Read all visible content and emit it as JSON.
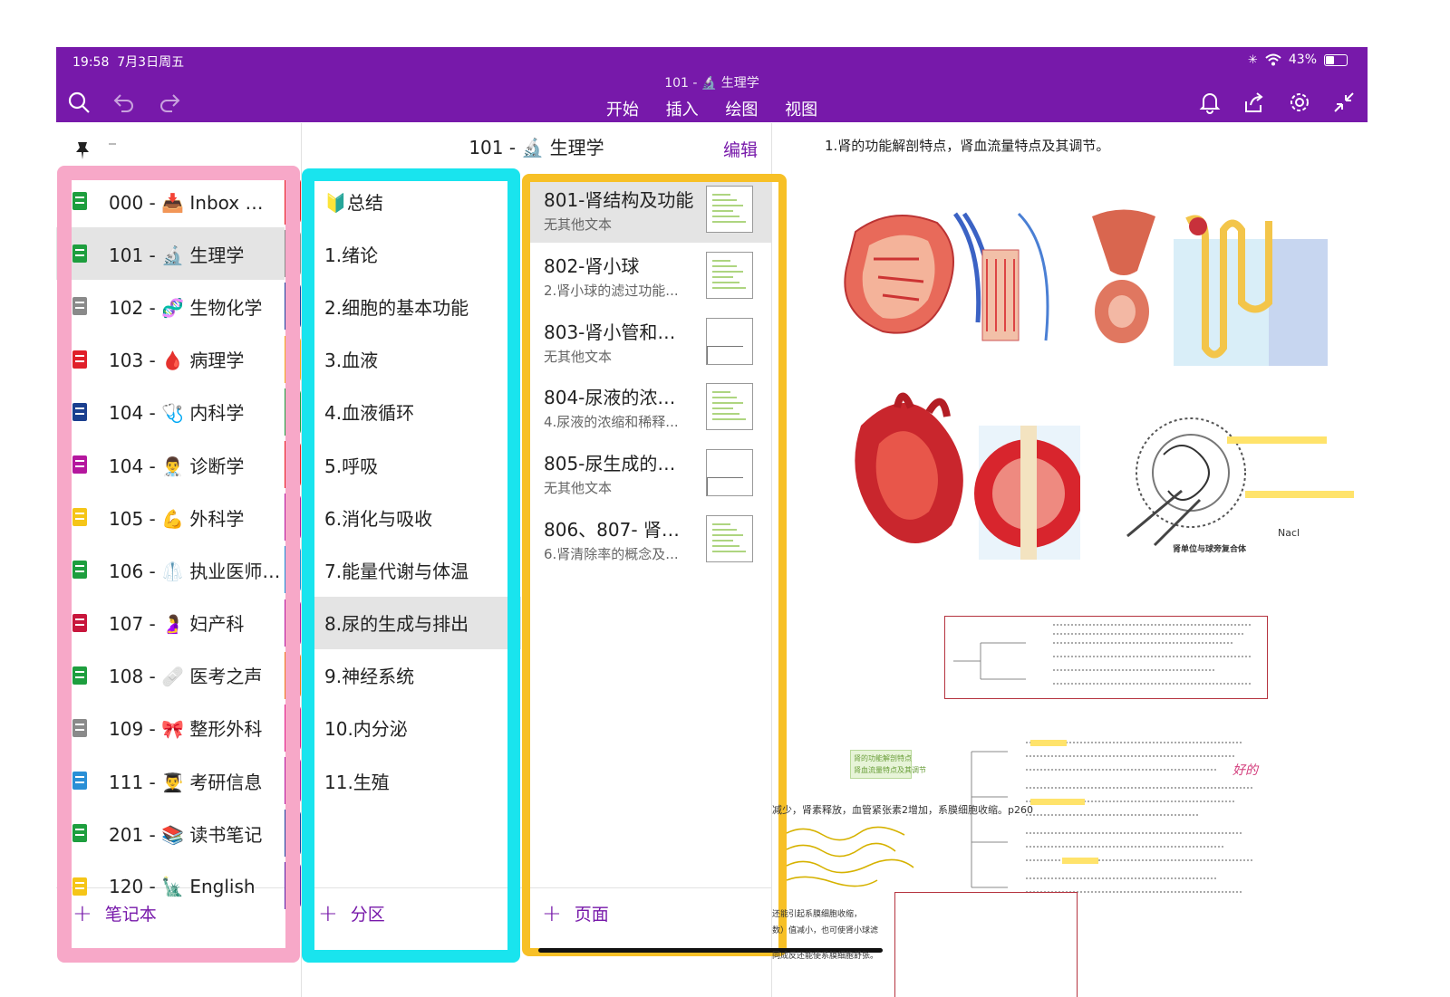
{
  "status": {
    "time": "19:58",
    "date": "7月3日周五",
    "battery": "43%",
    "battery_level": 0.43
  },
  "toolbar": {
    "doc_title": "101 - 🔬 生理学",
    "tabs": [
      "开始",
      "插入",
      "绘图",
      "视图"
    ]
  },
  "header": {
    "notebook_title": "101 - 🔬 生理学",
    "edit_label": "编辑"
  },
  "notebooks": [
    {
      "label": "000 - 📥 Inbox 文…",
      "color": "#1e9e3e"
    },
    {
      "label": "101 - 🔬 生理学",
      "color": "#1e9e3e",
      "selected": true
    },
    {
      "label": "102 - 🧬 生物化学",
      "color": "#8a8a8a"
    },
    {
      "label": "103 - 🩸 病理学",
      "color": "#e0202a"
    },
    {
      "label": "104 - 🩺 内科学",
      "color": "#1b3f8f"
    },
    {
      "label": "104 - 👨‍⚕️ 诊断学",
      "color": "#b5179e"
    },
    {
      "label": "105 - 💪 外科学",
      "color": "#f5c518"
    },
    {
      "label": "106 - 🥼 执业医师…",
      "color": "#1e9e3e"
    },
    {
      "label": "107 - 🤰 妇产科",
      "color": "#c8163c"
    },
    {
      "label": "108 - 🩹 医考之声",
      "color": "#1e9e3e"
    },
    {
      "label": "109 - 🎀 整形外科",
      "color": "#8a8a8a"
    },
    {
      "label": "111 - 👨‍🎓 考研信息",
      "color": "#2a8fd6"
    },
    {
      "label": "201 - 📚 读书笔记",
      "color": "#1e9e3e"
    },
    {
      "label": "120 - 🗽 English",
      "color": "#f5c518"
    }
  ],
  "section_tabs": [
    "#e8191f",
    "#8c8c8c",
    "#1d3fa0",
    "#f5a71a",
    "#1e9e3e",
    "#e8191f",
    "#b5179e",
    "#1d8ad6",
    "#b5179e",
    "#f07818",
    "#e01d8a",
    "#b5179e",
    "#1d3fa0",
    "#5a1ea8"
  ],
  "sections": [
    {
      "label": "🔰总结"
    },
    {
      "label": "1.绪论"
    },
    {
      "label": "2.细胞的基本功能"
    },
    {
      "label": "3.血液"
    },
    {
      "label": "4.血液循环"
    },
    {
      "label": "5.呼吸"
    },
    {
      "label": "6.消化与吸收"
    },
    {
      "label": "7.能量代谢与体温"
    },
    {
      "label": "8.尿的生成与排出",
      "selected": true
    },
    {
      "label": "9.神经系统"
    },
    {
      "label": "10.内分泌"
    },
    {
      "label": "11.生殖"
    }
  ],
  "pages": [
    {
      "title": "801-肾结构及功能",
      "sub": "无其他文本",
      "selected": true
    },
    {
      "title": "802-肾小球",
      "sub": "2.肾小球的滤过功能..."
    },
    {
      "title": "803-肾小管和…",
      "sub": "无其他文本"
    },
    {
      "title": "804-尿液的浓…",
      "sub": "4.尿液的浓缩和稀释..."
    },
    {
      "title": "805-尿生成的…",
      "sub": "无其他文本"
    },
    {
      "title": "806、807- 肾…",
      "sub": "6.肾清除率的概念及..."
    }
  ],
  "footer": {
    "add_notebook": "笔记本",
    "add_section": "分区",
    "add_page": "页面"
  },
  "canvas": {
    "heading": "1.肾的功能解剖特点，肾血流量特点及其调节。",
    "side_note": "肾血流量特点及其调节",
    "side_note_top": "肾的功能解剖特点",
    "text_line": "减少，肾素释放，血管紧张素2增加，系膜细胞收缩。p260",
    "text_line2": "还能引起系膜细胞收缩，",
    "text_line3": "数）值减小，也可使肾小球滤",
    "text_line4": "同成反还能使系膜细胞舒张。",
    "label_juxta": "肾单位与球旁复合体",
    "label_nacl": "Nacl"
  },
  "colors": {
    "brand": "#7719aa",
    "outline_pink": "#f7a8c8",
    "outline_cyan": "#19e4ee",
    "outline_yellow": "#f7c026"
  }
}
